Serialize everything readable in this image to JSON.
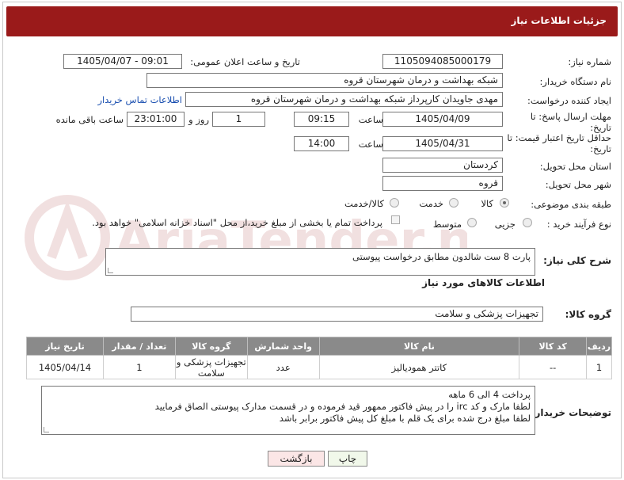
{
  "header": {
    "title": "جزئیات اطلاعات نیاز"
  },
  "fields": {
    "need_number_label": "شماره نیاز:",
    "need_number": "1105094085000179",
    "announce_label": "تاریخ و ساعت اعلان عمومی:",
    "announce_value": "1405/04/07 - 09:01",
    "buyer_org_label": "نام دستگاه خریدار:",
    "buyer_org": "شبکه بهداشت و درمان شهرستان قروه",
    "requester_label": "ایجاد کننده درخواست:",
    "requester": "مهدی جاویدان کارپرداز شبکه بهداشت و درمان شهرستان قروه",
    "contact_link": "اطلاعات تماس خریدار",
    "deadline_label": "مهلت ارسال پاسخ: تا تاریخ:",
    "deadline_date": "1405/04/09",
    "time_label": "ساعت",
    "deadline_time": "09:15",
    "days_value": "1",
    "days_label": "روز و",
    "remaining_value": "23:01:00",
    "remaining_label": "ساعت باقی مانده",
    "price_validity_label": "حداقل تاریخ اعتبار قیمت: تا تاریخ:",
    "price_validity_date": "1405/04/31",
    "price_validity_time": "14:00",
    "province_label": "استان محل تحویل:",
    "province": "کردستان",
    "city_label": "شهر محل تحویل:",
    "city": "قروه",
    "category_label": "طبقه بندی موضوعی:",
    "category_options": [
      "کالا",
      "خدمت",
      "کالا/خدمت"
    ],
    "process_label": "نوع فرآیند خرید :",
    "process_options": [
      "جزیی",
      "متوسط"
    ],
    "payment_note": "پرداخت تمام یا بخشی از مبلغ خرید،از محل \"اسناد خزانه اسلامی\" خواهد بود."
  },
  "description": {
    "label": "شرح کلی نیاز:",
    "value": "پارت 8 ست شالدون مطابق درخواست پیوستی"
  },
  "goods": {
    "section_title": "اطلاعات کالاهای مورد نیاز",
    "group_label": "گروه کالا:",
    "group_value": "تجهیزات پزشکی و سلامت",
    "columns": [
      "ردیف",
      "کد کالا",
      "نام کالا",
      "واحد شمارش",
      "گروه کالا",
      "تعداد / مقدار",
      "تاریخ نیاز"
    ],
    "rows": [
      {
        "row": "1",
        "code": "--",
        "name": "کاتتر همودیالیز",
        "unit": "عدد",
        "group": "تجهیزات پزشکی و سلامت",
        "qty": "1",
        "date": "1405/04/14"
      }
    ]
  },
  "buyer_notes": {
    "label": "توضیحات خریدار:",
    "line1": "پرداخت 4 الی 6 ماهه",
    "line2": "لطفا مارک و کد irc  را در پیش فاکتور ممهور قید فرموده و در قسمت مدارک پیوستی الصاق فرمایید",
    "line3": "لطفا مبلغ درج شده برای یک قلم با مبلغ کل پیش فاکتور برابر باشد"
  },
  "buttons": {
    "print": "چاپ",
    "back": "بازگشت"
  },
  "watermark": {
    "text": "AriaTender.neT"
  },
  "colors": {
    "header_bg": "#9a1a1a",
    "table_header_bg": "#8a8a8a",
    "link": "#1a4fb0"
  }
}
